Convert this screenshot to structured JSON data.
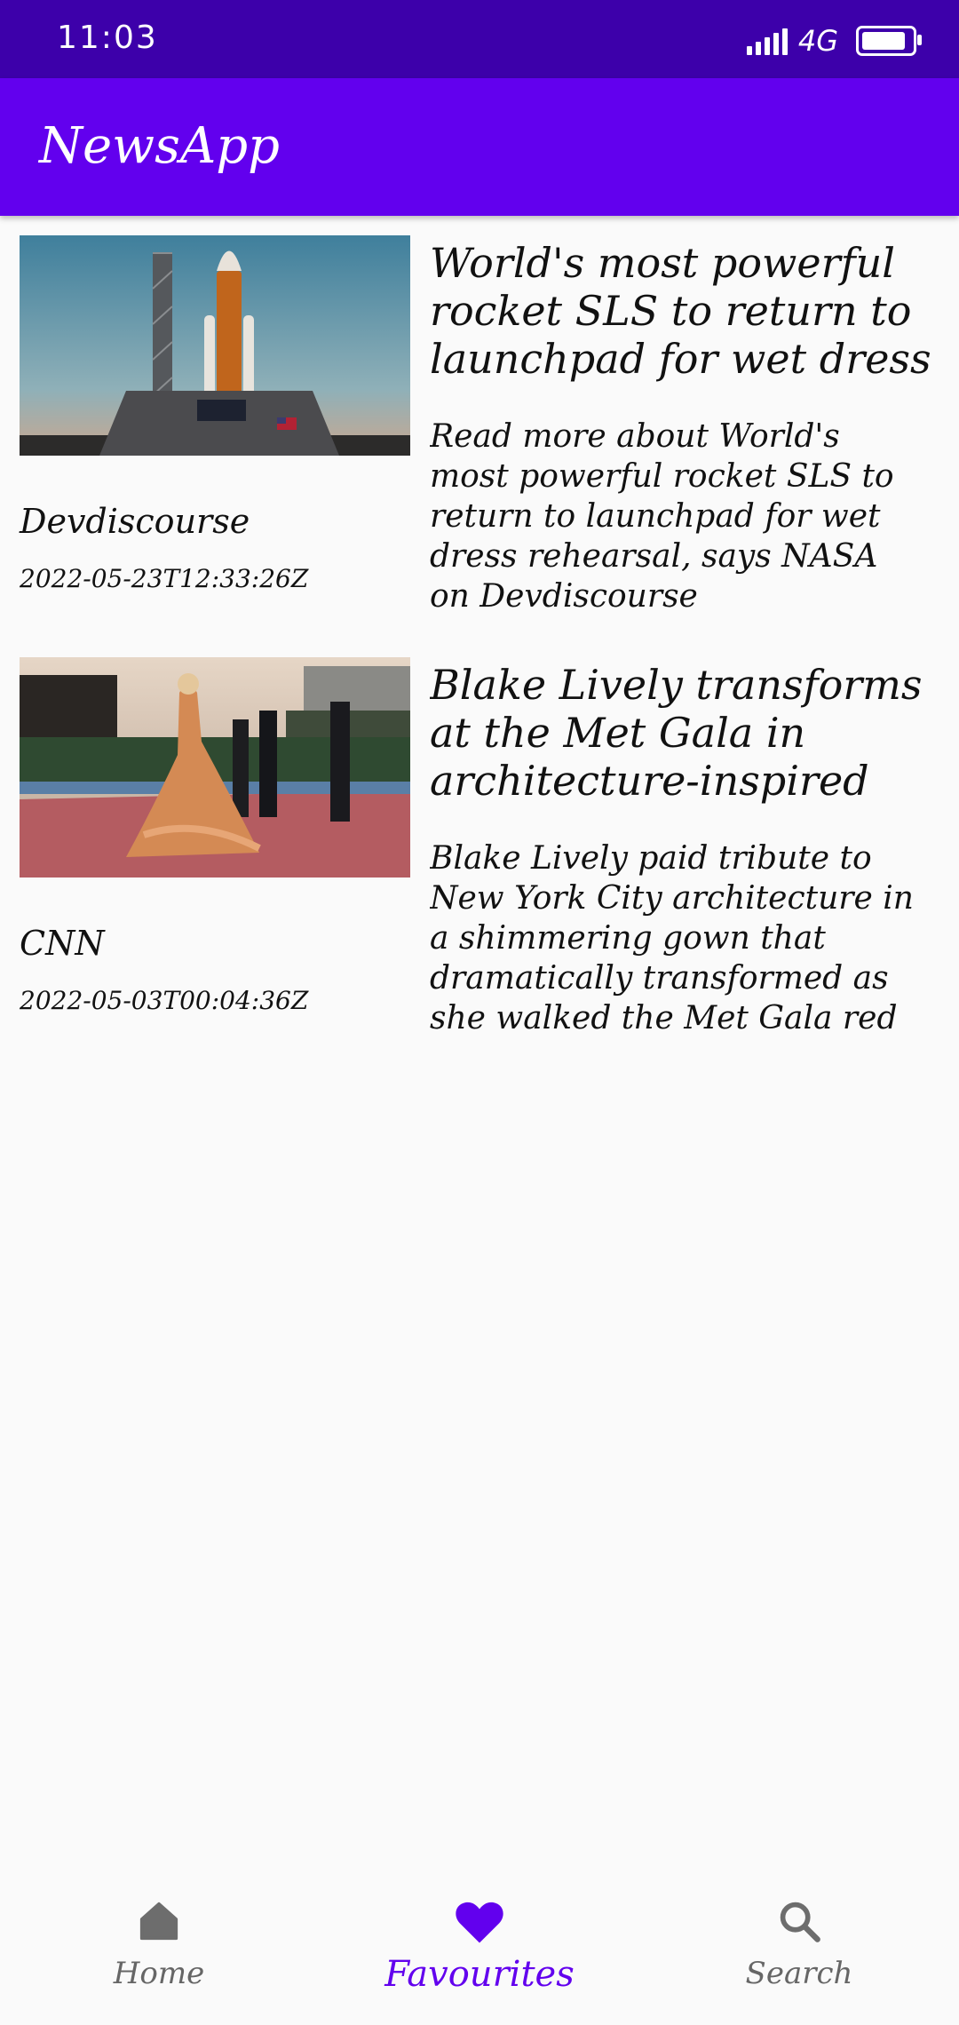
{
  "status_bar": {
    "time": "11:03",
    "network": "4G"
  },
  "app_bar": {
    "title": "NewsApp"
  },
  "articles": [
    {
      "headline": "World's most powerful rocket SLS to return to launchpad for wet dress ...",
      "description": "Read more about World's most powerful rocket SLS to return to launchpad for wet dress rehearsal, says NASA on Devdiscourse",
      "source": "Devdiscourse",
      "date": "2022-05-23T12:33:26Z"
    },
    {
      "headline": "Blake Lively transforms at the Met Gala in architecture-inspired Ve...",
      "description": "Blake Lively paid tribute to New York City architecture in a shimmering gown that dramatically transformed as she walked the Met Gala red c...",
      "source": "CNN",
      "date": "2022-05-03T00:04:36Z"
    }
  ],
  "bottom_nav": {
    "items": [
      {
        "label": "Home",
        "icon": "home-icon"
      },
      {
        "label": "Favourites",
        "icon": "heart-icon",
        "active": true
      },
      {
        "label": "Search",
        "icon": "search-icon"
      }
    ]
  },
  "colors": {
    "primary": "#6200ee",
    "primary_dark": "#3d00aa",
    "background": "#fafafa"
  }
}
